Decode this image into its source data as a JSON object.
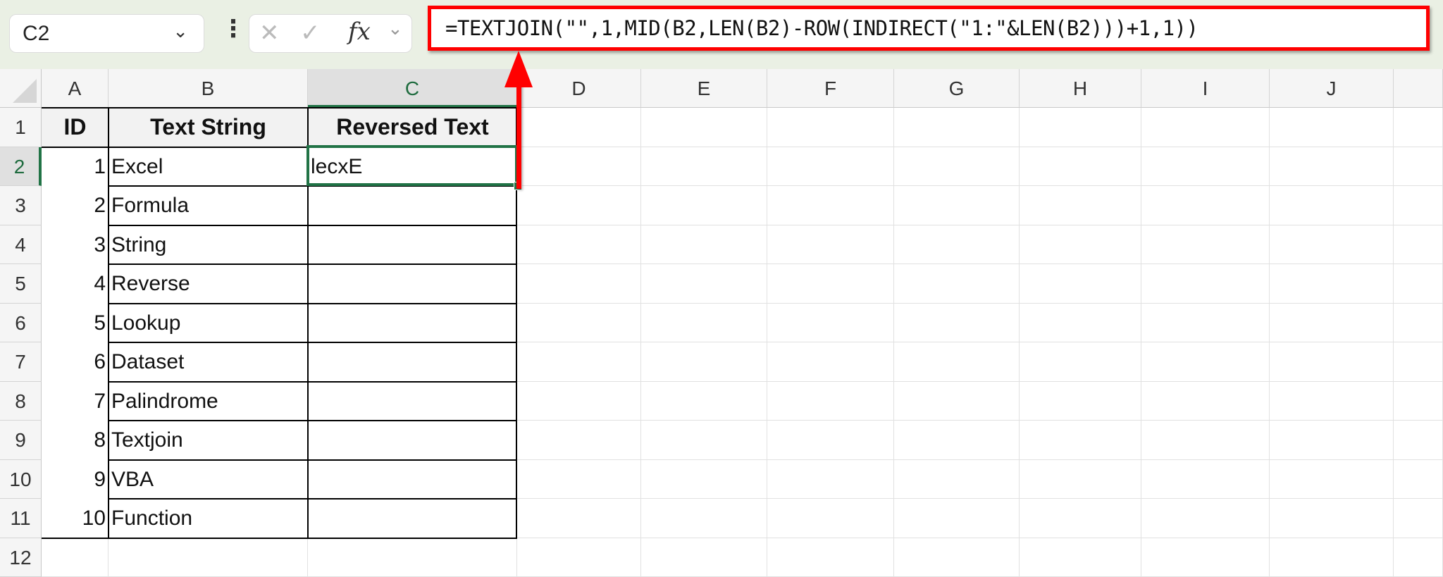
{
  "formula_bar": {
    "name_box": "C2",
    "name_box_chevron": "⌄",
    "more_icon": "⋮",
    "cancel_icon": "✕",
    "enter_icon": "✓",
    "fx_label": "fx",
    "fx_chevron": "⌄",
    "formula": "=TEXTJOIN(\"\",1,MID(B2,LEN(B2)-ROW(INDIRECT(\"1:\"&LEN(B2)))+1,1))"
  },
  "columns": [
    "A",
    "B",
    "C",
    "D",
    "E",
    "F",
    "G",
    "H",
    "I",
    "J"
  ],
  "rows": [
    "1",
    "2",
    "3",
    "4",
    "5",
    "6",
    "7",
    "8",
    "9",
    "10",
    "11",
    "12"
  ],
  "selected_cell": "C2",
  "table": {
    "headers": [
      "ID",
      "Text String",
      "Reversed Text"
    ],
    "rows": [
      {
        "id": "1",
        "text": "Excel",
        "reversed": "lecxE"
      },
      {
        "id": "2",
        "text": "Formula",
        "reversed": ""
      },
      {
        "id": "3",
        "text": "String",
        "reversed": ""
      },
      {
        "id": "4",
        "text": "Reverse",
        "reversed": ""
      },
      {
        "id": "5",
        "text": "Lookup",
        "reversed": ""
      },
      {
        "id": "6",
        "text": "Dataset",
        "reversed": ""
      },
      {
        "id": "7",
        "text": "Palindrome",
        "reversed": ""
      },
      {
        "id": "8",
        "text": "Textjoin",
        "reversed": ""
      },
      {
        "id": "9",
        "text": "VBA",
        "reversed": ""
      },
      {
        "id": "10",
        "text": "Function",
        "reversed": ""
      }
    ]
  },
  "colors": {
    "accent": "#217346",
    "annotation": "#ff0000"
  }
}
